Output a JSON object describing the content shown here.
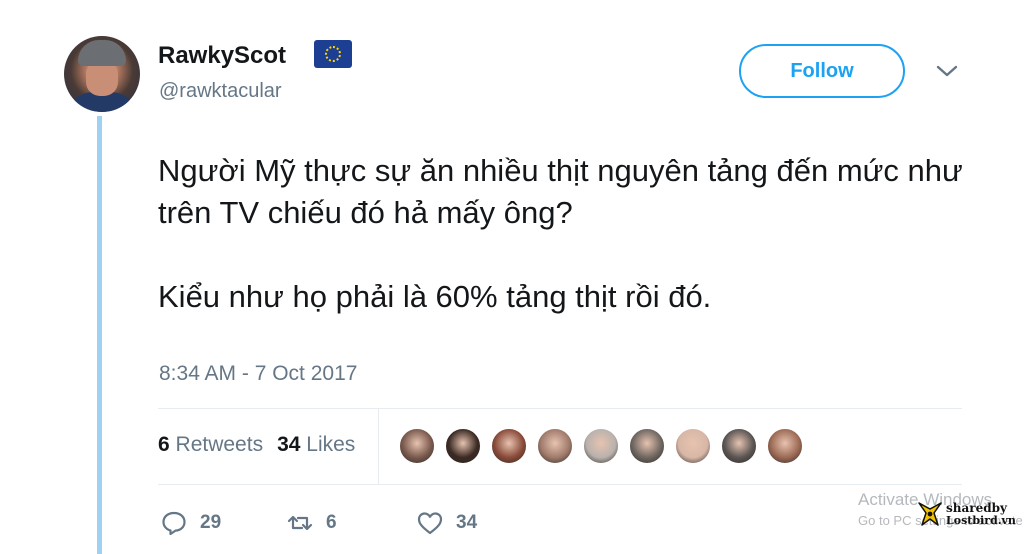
{
  "author": {
    "display_name": "RawkyScot",
    "flag_icon": "eu-flag-icon",
    "handle": "@rawktacular"
  },
  "follow_label": "Follow",
  "tweet": {
    "paragraphs": [
      "Người Mỹ thực sự ăn nhiều thịt nguyên tảng đến mức như trên TV chiếu đó hả mấy ông?",
      "Kiểu như họ phải là 60% tảng thịt rồi đó."
    ],
    "timestamp": "8:34 AM - 7 Oct 2017"
  },
  "stats": {
    "retweets_count": "6",
    "retweets_label": "Retweets",
    "likes_count": "34",
    "likes_label": "Likes"
  },
  "liker_avatars": [
    {
      "color": "#7a5a4e"
    },
    {
      "color": "#3b2a24"
    },
    {
      "color": "#8a4b3a"
    },
    {
      "color": "#a07b6c"
    },
    {
      "color": "#b9b2ad"
    },
    {
      "color": "#6f6761"
    },
    {
      "color": "#d8b7a7"
    },
    {
      "color": "#5b5654"
    },
    {
      "color": "#9c6a55"
    }
  ],
  "actions": {
    "reply_count": "29",
    "retweet_count": "6",
    "like_count": "34"
  },
  "watermark": {
    "activate_text": "Activate Windows",
    "goto_text": "Go to PC settings to activate",
    "logo_line1": "sharedby",
    "logo_line2": "Lostbird.vn"
  },
  "colors": {
    "accent": "#1da1f2",
    "thread_line": "#9fd1f3",
    "secondary_text": "#657786"
  }
}
